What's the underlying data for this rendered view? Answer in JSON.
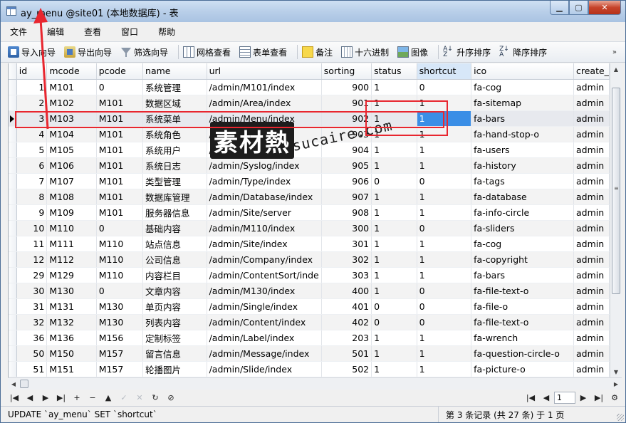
{
  "window": {
    "title": "ay_menu @site01 (本地数据库) - 表"
  },
  "menubar": [
    "文件",
    "编辑",
    "查看",
    "窗口",
    "帮助"
  ],
  "toolbar": {
    "import": "导入向导",
    "export": "导出向导",
    "filter": "筛选向导",
    "grid_view": "网格查看",
    "form_view": "表单查看",
    "note": "备注",
    "hex": "十六进制",
    "image": "图像",
    "sort_asc": "升序排序",
    "sort_desc": "降序排序",
    "more": "»"
  },
  "table": {
    "columns": [
      "id",
      "mcode",
      "pcode",
      "name",
      "url",
      "sorting",
      "status",
      "shortcut",
      "ico",
      "create_"
    ],
    "rows": [
      [
        "1",
        "M101",
        "0",
        "系统管理",
        "/admin/M101/index",
        "900",
        "1",
        "0",
        "fa-cog",
        "admin"
      ],
      [
        "2",
        "M102",
        "M101",
        "数据区域",
        "/admin/Area/index",
        "901",
        "1",
        "1",
        "fa-sitemap",
        "admin"
      ],
      [
        "3",
        "M103",
        "M101",
        "系统菜单",
        "/admin/Menu/index",
        "902",
        "1",
        "1",
        "fa-bars",
        "admin"
      ],
      [
        "4",
        "M104",
        "M101",
        "系统角色",
        "/admin/Role/index",
        "903",
        "1",
        "1",
        "fa-hand-stop-o",
        "admin"
      ],
      [
        "5",
        "M105",
        "M101",
        "系统用户",
        "/admin/User/index",
        "904",
        "1",
        "1",
        "fa-users",
        "admin"
      ],
      [
        "6",
        "M106",
        "M101",
        "系统日志",
        "/admin/Syslog/index",
        "905",
        "1",
        "1",
        "fa-history",
        "admin"
      ],
      [
        "7",
        "M107",
        "M101",
        "类型管理",
        "/admin/Type/index",
        "906",
        "0",
        "0",
        "fa-tags",
        "admin"
      ],
      [
        "8",
        "M108",
        "M101",
        "数据库管理",
        "/admin/Database/index",
        "907",
        "1",
        "1",
        "fa-database",
        "admin"
      ],
      [
        "9",
        "M109",
        "M101",
        "服务器信息",
        "/admin/Site/server",
        "908",
        "1",
        "1",
        "fa-info-circle",
        "admin"
      ],
      [
        "10",
        "M110",
        "0",
        "基础内容",
        "/admin/M110/index",
        "300",
        "1",
        "0",
        "fa-sliders",
        "admin"
      ],
      [
        "11",
        "M111",
        "M110",
        "站点信息",
        "/admin/Site/index",
        "301",
        "1",
        "1",
        "fa-cog",
        "admin"
      ],
      [
        "12",
        "M112",
        "M110",
        "公司信息",
        "/admin/Company/index",
        "302",
        "1",
        "1",
        "fa-copyright",
        "admin"
      ],
      [
        "29",
        "M129",
        "M110",
        "内容栏目",
        "/admin/ContentSort/inde",
        "303",
        "1",
        "1",
        "fa-bars",
        "admin"
      ],
      [
        "30",
        "M130",
        "0",
        "文章内容",
        "/admin/M130/index",
        "400",
        "1",
        "0",
        "fa-file-text-o",
        "admin"
      ],
      [
        "31",
        "M131",
        "M130",
        "单页内容",
        "/admin/Single/index",
        "401",
        "0",
        "0",
        "fa-file-o",
        "admin"
      ],
      [
        "32",
        "M132",
        "M130",
        "列表内容",
        "/admin/Content/index",
        "402",
        "0",
        "0",
        "fa-file-text-o",
        "admin"
      ],
      [
        "36",
        "M136",
        "M156",
        "定制标签",
        "/admin/Label/index",
        "203",
        "1",
        "1",
        "fa-wrench",
        "admin"
      ],
      [
        "50",
        "M150",
        "M157",
        "留言信息",
        "/admin/Message/index",
        "501",
        "1",
        "1",
        "fa-question-circle-o",
        "admin"
      ],
      [
        "51",
        "M151",
        "M157",
        "轮播图片",
        "/admin/Slide/index",
        "502",
        "1",
        "1",
        "fa-picture-o",
        "admin"
      ]
    ],
    "current_row_index": 2,
    "selected_column": "shortcut"
  },
  "navbar": {
    "buttons": [
      "|◀",
      "◀",
      "▶",
      "▶|",
      "+",
      "−",
      "▲",
      "✓",
      "✕",
      "↻",
      "⊘"
    ],
    "page": "1"
  },
  "status": {
    "sql": "UPDATE `ay_menu` SET `shortcut`",
    "record_info": "第 3 条记录 (共 27 条) 于 1 页"
  },
  "watermark": {
    "logo": "素材熱",
    "text": "sucaire.com"
  },
  "colors": {
    "selection": "#3a8ee6",
    "annotation": "#e8262f",
    "title_bar": "#b9cfe9"
  }
}
